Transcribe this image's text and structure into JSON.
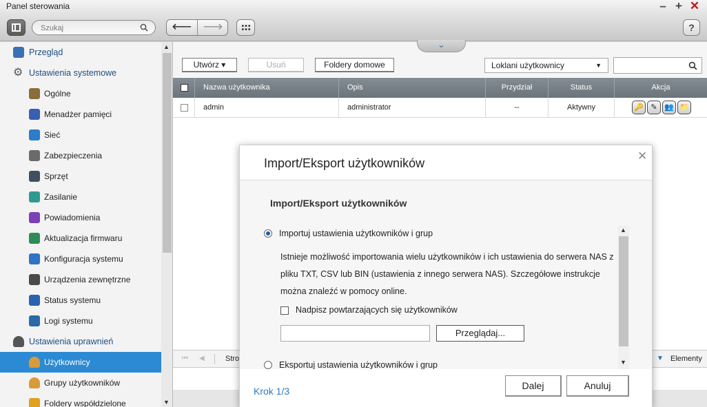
{
  "window": {
    "title": "Panel sterowania",
    "min_glyph": "–",
    "max_glyph": "+",
    "close_glyph": "✕"
  },
  "toolbar": {
    "search_placeholder": "Szukaj",
    "back_glyph": "⟵",
    "forward_glyph": "⟶",
    "help_label": "?",
    "expand_glyph": "⌄"
  },
  "sidebar": {
    "items": [
      {
        "label": "Przegląd",
        "level": "category",
        "icon": "overview-icon",
        "color": "#3b6fb6"
      },
      {
        "label": "Ustawienia systemowe",
        "level": "category",
        "icon": "gear-icon",
        "color": "#555555"
      },
      {
        "label": "Ogólne",
        "level": "sub",
        "icon": "general-settings-icon",
        "color": "#8a6d3b"
      },
      {
        "label": "Menadżer pamięci",
        "level": "sub",
        "icon": "storage-icon",
        "color": "#3a5fb0"
      },
      {
        "label": "Sieć",
        "level": "sub",
        "icon": "network-icon",
        "color": "#2e7dc8"
      },
      {
        "label": "Zabezpieczenia",
        "level": "sub",
        "icon": "lock-icon",
        "color": "#6b6b6b"
      },
      {
        "label": "Sprzęt",
        "level": "sub",
        "icon": "hardware-icon",
        "color": "#3f4f5e"
      },
      {
        "label": "Zasilanie",
        "level": "sub",
        "icon": "power-bulb-icon",
        "color": "#2f9a8f"
      },
      {
        "label": "Powiadomienia",
        "level": "sub",
        "icon": "notification-icon",
        "color": "#7b3fb6"
      },
      {
        "label": "Aktualizacja firmwaru",
        "level": "sub",
        "icon": "firmware-update-icon",
        "color": "#2e8b57"
      },
      {
        "label": "Konfiguracja systemu",
        "level": "sub",
        "icon": "system-config-icon",
        "color": "#2e73c4"
      },
      {
        "label": "Urządzenia zewnętrzne",
        "level": "sub",
        "icon": "external-device-icon",
        "color": "#4a4a4a"
      },
      {
        "label": "Status systemu",
        "level": "sub",
        "icon": "system-status-icon",
        "color": "#2a62b0"
      },
      {
        "label": "Logi systemu",
        "level": "sub",
        "icon": "system-logs-icon",
        "color": "#2a6aa8"
      },
      {
        "label": "Ustawienia uprawnień",
        "level": "category",
        "icon": "user-permissions-icon",
        "color": "#555555"
      },
      {
        "label": "Użytkownicy",
        "level": "sub",
        "icon": "user-icon",
        "color": "#d89a3a",
        "active": true
      },
      {
        "label": "Grupy użytkowników",
        "level": "sub",
        "icon": "user-group-icon",
        "color": "#d89a3a"
      },
      {
        "label": "Foldery współdzielone",
        "level": "sub",
        "icon": "shared-folder-icon",
        "color": "#e0a020"
      }
    ]
  },
  "actions": {
    "create_label": "Utwórz ▾",
    "delete_label": "Usuń",
    "home_folders_label": "Foldery domowe",
    "filter_value": "Loklani użytkownicy",
    "filter_arrow": "▼"
  },
  "table": {
    "headers": {
      "name": "Nazwa użytkownika",
      "description": "Opis",
      "quota": "Przydział",
      "status": "Status",
      "action": "Akcja"
    },
    "rows": [
      {
        "name": "admin",
        "description": "administrator",
        "quota": "--",
        "status": "Aktywny"
      }
    ]
  },
  "pager": {
    "page_label": "Stro",
    "first_glyph": "⏮",
    "prev_glyph": "◀",
    "per_page_arrow": "▼",
    "items_label": "Elementy"
  },
  "dialog": {
    "title": "Import/Eksport użytkowników",
    "close_glyph": "✕",
    "section_title": "Import/Eksport użytkowników",
    "import_option": "Importuj ustawienia użytkowników i grup",
    "import_description": "Istnieje możliwość importowania wielu użytkowników i ich ustawienia do serwera NAS z pliku TXT, CSV lub BIN (ustawienia z innego serwera NAS). Szczegółowe instrukcje można znaleźć w pomocy online.",
    "overwrite_label": "Nadpisz powtarzających się użytkowników",
    "browse_label": "Przeglądaj...",
    "export_option": "Eksportuj ustawienia użytkowników i grup",
    "step_label": "Krok 1/3",
    "next_label": "Dalej",
    "cancel_label": "Anuluj"
  }
}
